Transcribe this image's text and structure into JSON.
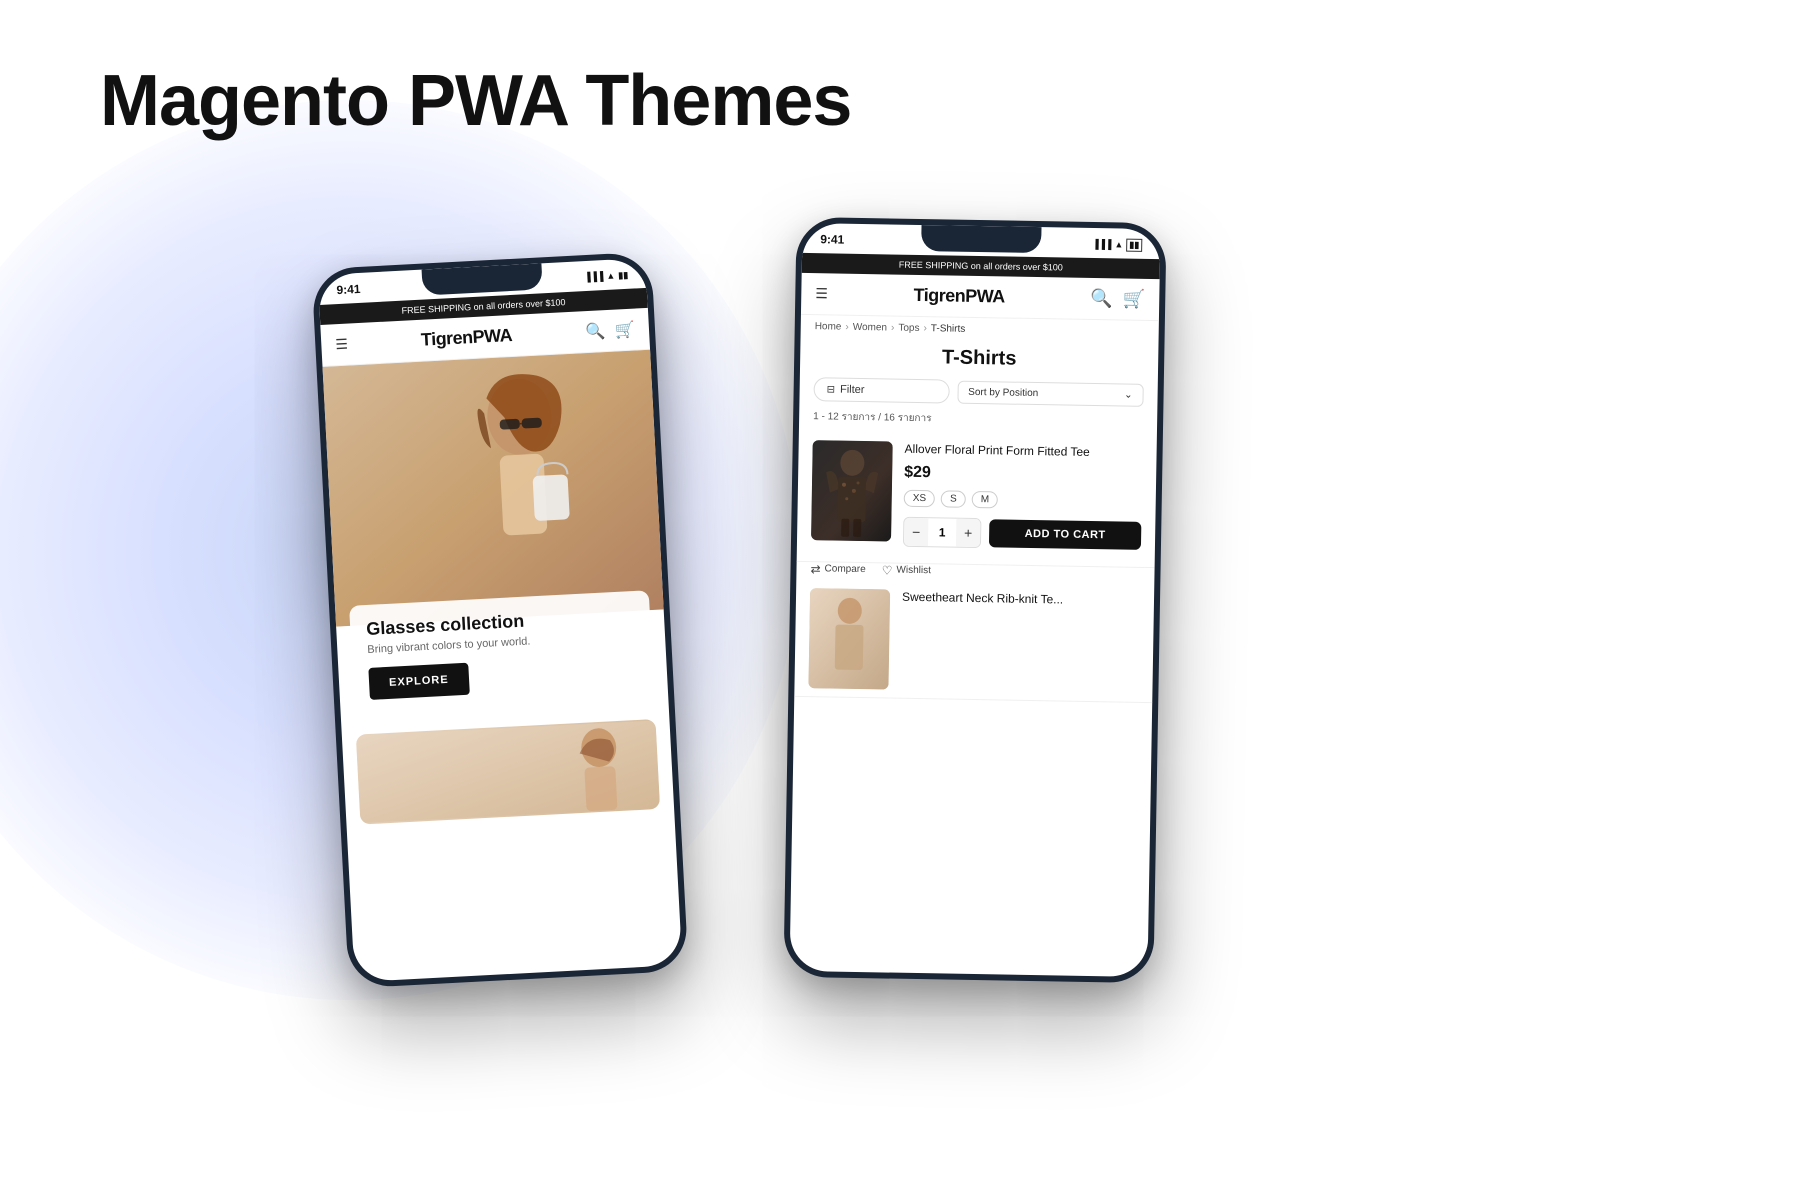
{
  "page": {
    "title": "Magento PWA Themes",
    "background_color": "#ffffff"
  },
  "phone1": {
    "time": "9:41",
    "promo_bar": "FREE SHIPPING on all orders over $100",
    "logo": "TigrenPWA",
    "hero": {
      "collection_title": "Glasses collection",
      "collection_subtitle": "Bring vibrant colors to your world.",
      "explore_button": "EXPLORE"
    }
  },
  "phone2": {
    "time": "9:41",
    "promo_bar": "FREE SHIPPING on all orders over $100",
    "logo": "TigrenPWA",
    "breadcrumb": [
      "Home",
      "Women",
      "Tops",
      "T-Shirts"
    ],
    "category_title": "T-Shirts",
    "filter_label": "Filter",
    "sort_label": "Sort by Position",
    "results_count": "1 - 12 รายการ / 16 รายการ",
    "product1": {
      "name": "Allover Floral Print Form Fitted Tee",
      "price": "$29",
      "sizes": [
        "XS",
        "S",
        "M"
      ],
      "quantity": "1",
      "add_to_cart": "ADD TO CART",
      "compare_label": "Compare",
      "wishlist_label": "Wishlist"
    },
    "product2": {
      "name": "Sweetheart Neck Rib-knit Te..."
    }
  }
}
